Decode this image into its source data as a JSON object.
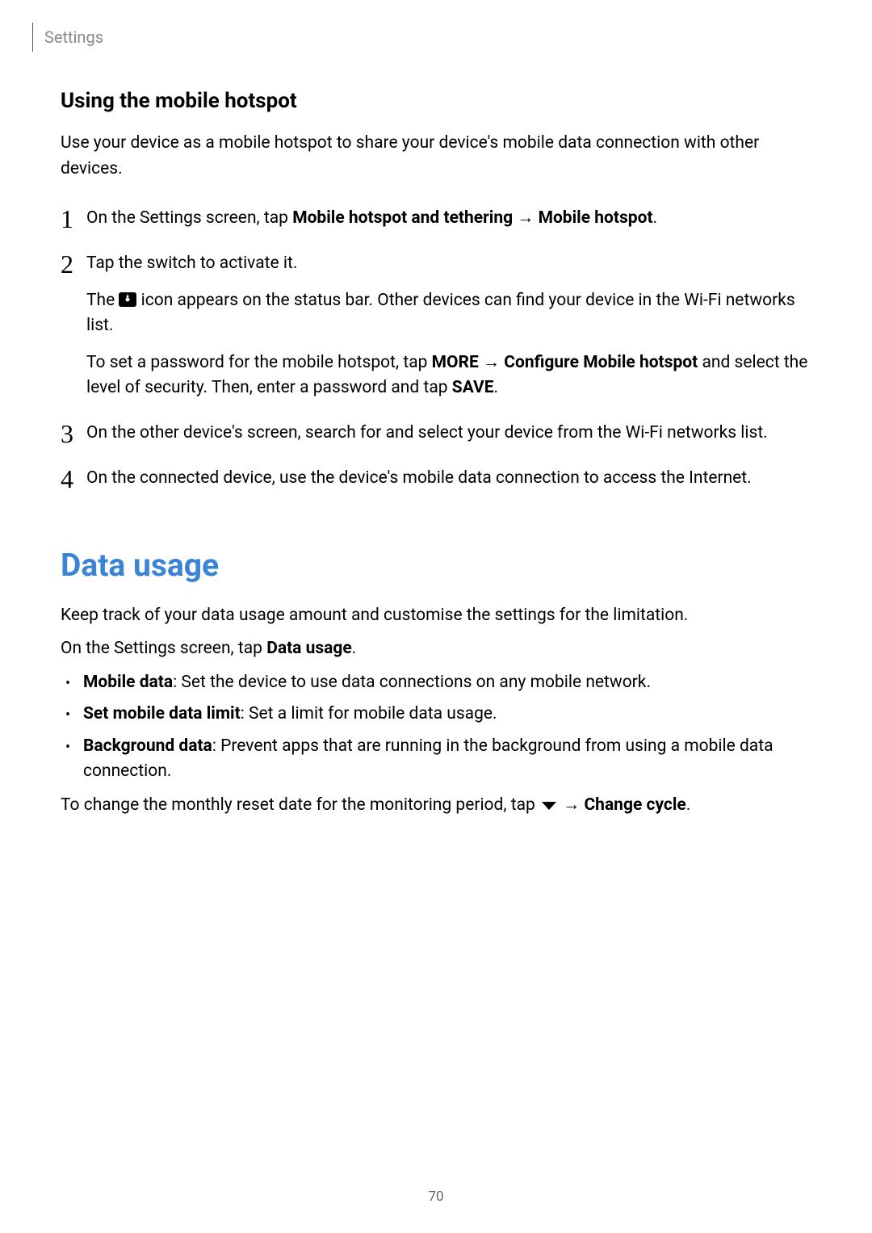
{
  "header": {
    "breadcrumb": "Settings"
  },
  "hotspot": {
    "heading": "Using the mobile hotspot",
    "intro": "Use your device as a mobile hotspot to share your device's mobile data connection with other devices.",
    "steps": {
      "n1": "1",
      "n2": "2",
      "n3": "3",
      "n4": "4",
      "s1_pre": "On the Settings screen, tap ",
      "s1_b1": "Mobile hotspot and tethering",
      "s1_arrow": " → ",
      "s1_b2": "Mobile hotspot",
      "s1_post": ".",
      "s2_p1": "Tap the switch to activate it.",
      "s2_p2_pre": "The ",
      "s2_p2_post": " icon appears on the status bar. Other devices can find your device in the Wi-Fi networks list.",
      "s2_p3_pre": "To set a password for the mobile hotspot, tap ",
      "s2_p3_b1": "MORE",
      "s2_p3_arrow": " → ",
      "s2_p3_b2": "Configure Mobile hotspot",
      "s2_p3_mid": " and select the level of security. Then, enter a password and tap ",
      "s2_p3_b3": "SAVE",
      "s2_p3_post": ".",
      "s3": "On the other device's screen, search for and select your device from the Wi-Fi networks list.",
      "s4": "On the connected device, use the device's mobile data connection to access the Internet."
    }
  },
  "datausage": {
    "heading": "Data usage",
    "p1": "Keep track of your data usage amount and customise the settings for the limitation.",
    "p2_pre": "On the Settings screen, tap ",
    "p2_b": "Data usage",
    "p2_post": ".",
    "bullets": {
      "b1_b": "Mobile data",
      "b1_t": ": Set the device to use data connections on any mobile network.",
      "b2_b": "Set mobile data limit",
      "b2_t": ": Set a limit for mobile data usage.",
      "b3_b": "Background data",
      "b3_t": ": Prevent apps that are running in the background from using a mobile data connection."
    },
    "p3_pre": "To change the monthly reset date for the monitoring period, tap ",
    "p3_arrow": " → ",
    "p3_b": "Change cycle",
    "p3_post": "."
  },
  "page_number": "70"
}
